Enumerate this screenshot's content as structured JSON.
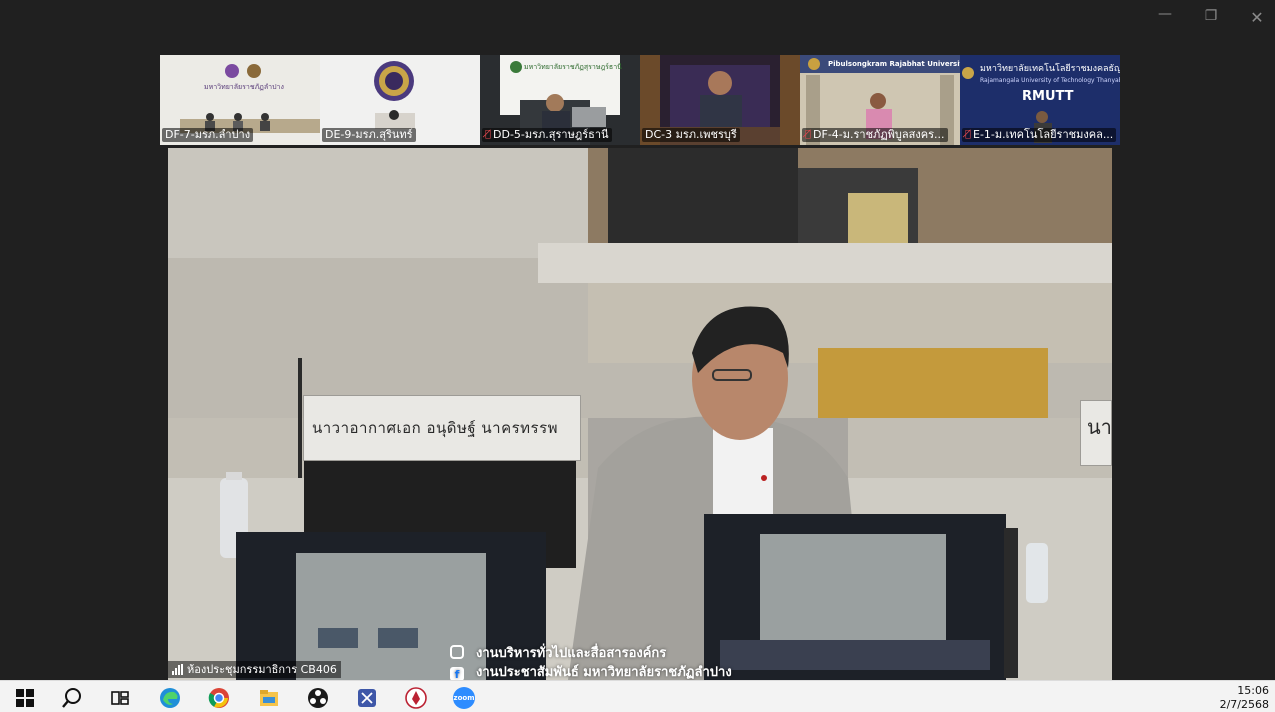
{
  "window": {
    "minimize": "—",
    "maximize": "❐",
    "close": "✕"
  },
  "participants": [
    {
      "name": "DF-7-มรภ.ลำปาง",
      "muted": false,
      "logo_text": "มหาวิทยาลัยราชภัฏลำปาง"
    },
    {
      "name": "DE-9-มรภ.สุรินทร์",
      "muted": false
    },
    {
      "name": "DD-5-มรภ.สุราษฎร์ธานี",
      "muted": true,
      "logo_text": "มหาวิทยาลัยราชภัฏสุราษฎร์ธานี"
    },
    {
      "name": "DC-3 มรภ.เพชรบุรี",
      "muted": false
    },
    {
      "name": "DF-4-ม.ราชภัฏพิบูลสงคร...",
      "muted": true,
      "logo_text": "Pibulsongkram Rajabhat University"
    },
    {
      "name": "E-1-ม.เทคโนโลยีราชมงคล...",
      "muted": true,
      "logo_text": "มหาวิทยาลัยเทคโนโลยีราชมงคลธัญบุรี",
      "logo_sub": "Rajamangala University of Technology Thanyaburi",
      "brand": "RMUTT"
    }
  ],
  "main_video": {
    "nameplate": "นาวาอากาศเอก อนุดิษฐ์  นาครทรรพ",
    "nameplate_right": "นา",
    "overlay_lines": [
      "งานบริหารทั่วไปและสื่อสารองค์กร",
      "งานประชาสัมพันธ์ มหาวิทยาลัยราชภัฏลำปาง"
    ],
    "room_label": "ห้องประชุมกรรมาธิการ CB406"
  },
  "taskbar": {
    "apps": [
      "start-icon",
      "search-icon",
      "task-view-icon",
      "edge-icon",
      "chrome-icon",
      "file-explorer-icon",
      "obs-icon",
      "snip-icon",
      "app-emblem-icon",
      "zoom-icon"
    ],
    "zoom_label": "zoom",
    "time": "15:06",
    "date": "2/7/2568"
  },
  "colors": {
    "taskbar_bg": "#f3f3f3",
    "app_bg": "#202020",
    "mute_red": "#e5484d",
    "zoom_blue": "#2d8cff"
  }
}
